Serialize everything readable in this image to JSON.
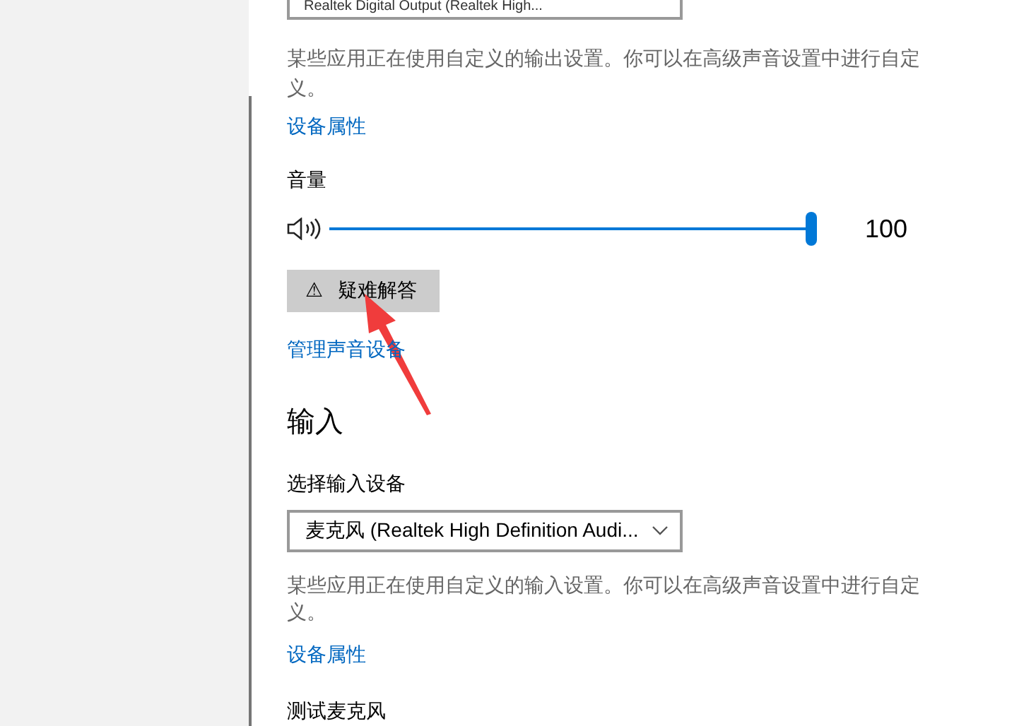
{
  "output": {
    "device_select": {
      "value": "Realtek Digital Output (Realtek High..."
    },
    "note": "某些应用正在使用自定义的输出设置。你可以在高级声音设置中进行自定义。",
    "properties_link": "设备属性",
    "volume": {
      "label": "音量",
      "level": 1.0,
      "reading": "100"
    },
    "troubleshoot_button": {
      "icon": "⚠",
      "label": "疑难解答"
    },
    "manage_link": "管理声音设备"
  },
  "input": {
    "heading": "输入",
    "select_label": "选择输入设备",
    "device_select": {
      "value": "麦克风 (Realtek High Definition Audi..."
    },
    "note": "某些应用正在使用自定义的输入设置。你可以在高级声音设置中进行自定义。",
    "properties_link": "设备属性",
    "test_label": "测试麦克风"
  }
}
